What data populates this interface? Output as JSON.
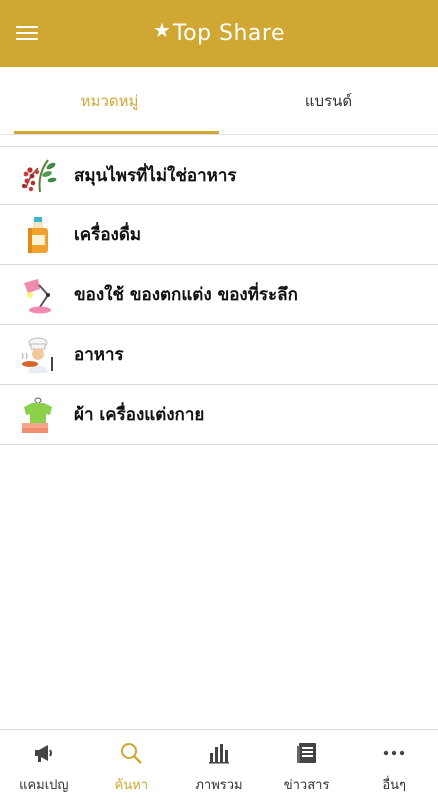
{
  "theme": {
    "accent": "#cfa732"
  },
  "header": {
    "title": "Top Share",
    "menu_icon": "menu-icon",
    "star_icon": "star-icon"
  },
  "tabs": [
    {
      "label": "หมวดหมู่",
      "active": true
    },
    {
      "label": "แบรนด์",
      "active": false
    }
  ],
  "categories": [
    {
      "label": "สมุนไพรที่ไม่ใช่อาหาร",
      "icon": "herb-icon"
    },
    {
      "label": "เครื่องดื่ม",
      "icon": "bottle-icon"
    },
    {
      "label": "ของใช้ ของตกแต่ง ของที่ระลึก",
      "icon": "lamp-icon"
    },
    {
      "label": "อาหาร",
      "icon": "chef-icon"
    },
    {
      "label": "ผ้า เครื่องแต่งกาย",
      "icon": "clothing-icon"
    }
  ],
  "bottom_nav": [
    {
      "label": "แคมเปญ",
      "icon": "megaphone-icon",
      "active": false
    },
    {
      "label": "ค้นหา",
      "icon": "search-icon",
      "active": true
    },
    {
      "label": "ภาพรวม",
      "icon": "bar-chart-icon",
      "active": false
    },
    {
      "label": "ข่าวสาร",
      "icon": "news-icon",
      "active": false
    },
    {
      "label": "อื่นๆ",
      "icon": "more-icon",
      "active": false
    }
  ]
}
